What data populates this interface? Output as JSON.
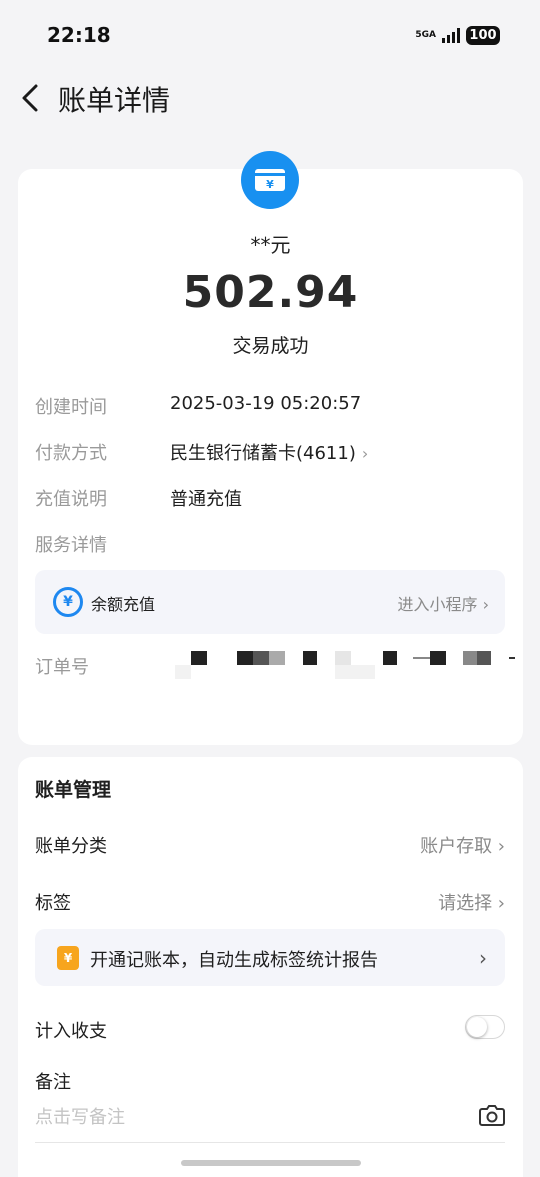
{
  "status_bar": {
    "time": "22:18",
    "network": "5GA",
    "battery": "100"
  },
  "nav": {
    "title": "账单详情"
  },
  "summary": {
    "merchant": "**元",
    "amount": "502.94",
    "status": "交易成功"
  },
  "details": {
    "rows": [
      {
        "label": "创建时间",
        "value": "2025-03-19 05:20:57"
      },
      {
        "label": "付款方式",
        "value": "民生银行储蓄卡(4611)"
      },
      {
        "label": "充值说明",
        "value": "普通充值"
      },
      {
        "label": "服务详情",
        "value": ""
      }
    ],
    "service": {
      "icon": "yen-icon",
      "name": "余额充值",
      "link": "进入小程序"
    },
    "order": {
      "label": "订单号"
    }
  },
  "management": {
    "title": "账单管理",
    "category": {
      "label": "账单分类",
      "value": "账户存取"
    },
    "tags": {
      "label": "标签",
      "value": "请选择"
    },
    "promo": {
      "icon": "ledger-yen-icon",
      "text": "开通记账本，自动生成标签统计报告"
    },
    "count": {
      "label": "计入收支",
      "enabled": false
    },
    "remark": {
      "label": "备注",
      "placeholder": "点击写备注"
    }
  },
  "colors": {
    "accent": "#1890f0",
    "promo": "#f7a51e",
    "background": "#f4f4f6"
  }
}
